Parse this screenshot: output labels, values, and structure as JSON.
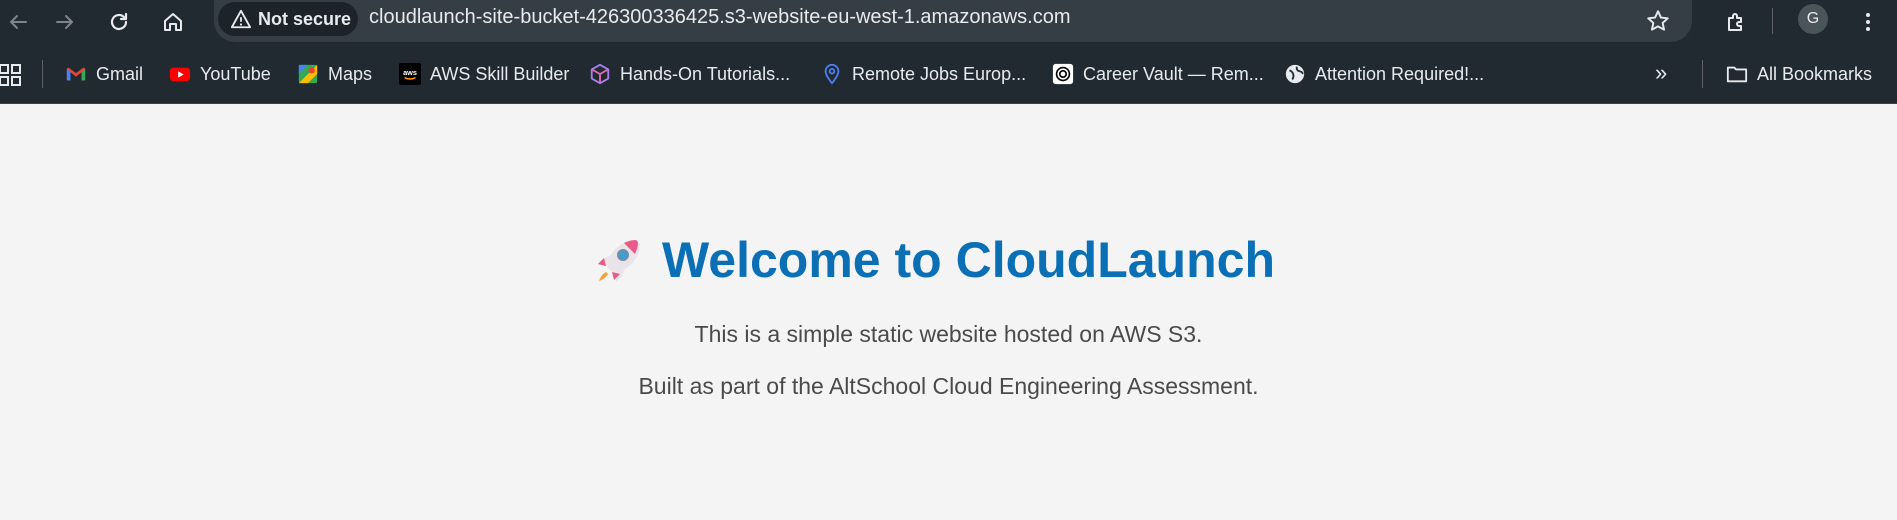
{
  "browser": {
    "back_icon": "arrow-left-icon",
    "forward_icon": "arrow-right-icon",
    "reload_icon": "reload-icon",
    "home_icon": "home-icon",
    "security_chip": {
      "icon": "warning-triangle-icon",
      "label": "Not secure"
    },
    "url": "cloudlaunch-site-bucket-426300336425.s3-website-eu-west-1.amazonaws.com",
    "profile_initial": "G"
  },
  "bookmarks": {
    "items": [
      {
        "label": "Gmail",
        "icon": "gmail-icon"
      },
      {
        "label": "YouTube",
        "icon": "youtube-icon"
      },
      {
        "label": "Maps",
        "icon": "maps-icon"
      },
      {
        "label": "AWS Skill Builder",
        "icon": "aws-icon"
      },
      {
        "label": "Hands-On Tutorials...",
        "icon": "cube-icon"
      },
      {
        "label": "Remote Jobs Europ...",
        "icon": "location-pin-icon"
      },
      {
        "label": "Career Vault — Rem...",
        "icon": "vault-icon"
      },
      {
        "label": "Attention Required!...",
        "icon": "globe-icon"
      }
    ],
    "more": "»",
    "all_bookmarks": "All Bookmarks"
  },
  "page": {
    "title": "Welcome to CloudLaunch",
    "line1": "This is a simple static website hosted on AWS S3.",
    "line2": "Built as part of the AltSchool Cloud Engineering Assessment."
  },
  "colors": {
    "chrome_bg": "#202a30",
    "omnibox_bg": "#343e44",
    "page_bg": "#f4f4f4",
    "heading": "#0a6fb5",
    "body_text": "#4a4a4a"
  }
}
